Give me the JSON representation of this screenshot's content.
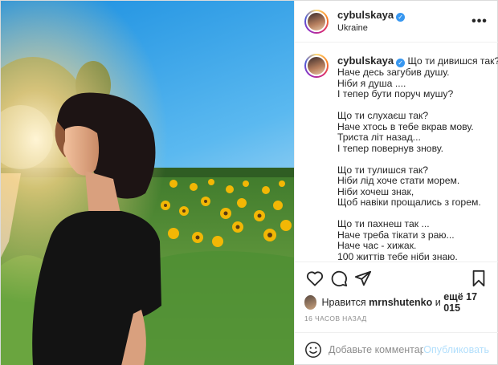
{
  "post": {
    "username": "cybulskaya",
    "verified_mark": "✓",
    "location": "Ukraine",
    "more_icon": "•••",
    "caption_lines": [
      "Що ти дивишся так?",
      "Наче десь загубив душу.",
      "Ніби я душа ....",
      "І тепер бути поруч мушу?",
      "",
      "Що ти слухаєш так?",
      "Наче хтось в тебе вкрав мову.",
      "Триста літ назад...",
      "І тепер повернув знову.",
      "",
      "Що ти тулишся так?",
      "Ніби лід хоче стати морем.",
      "Ніби хочеш знак,",
      "Щоб навіки прощались з горем.",
      "",
      "Що ти пахнеш так ...",
      "Наче треба тікати з раю...",
      "Наче час - хижак.",
      "100 життів тебе ніби знаю."
    ],
    "likes": {
      "prefix": "Нравится",
      "user": "mrnshutenko",
      "middle": "и",
      "count": "ещё 17 015"
    },
    "timestamp": "16 часов назад",
    "comment": {
      "placeholder": "Добавьте комментарий...",
      "post_label": "Опубликовать",
      "value": ""
    },
    "icons": {
      "like": "heart-icon",
      "comment": "comment-icon",
      "share": "share-icon",
      "save": "bookmark-icon",
      "emoji": "smile-icon",
      "more": "more-icon"
    },
    "colors": {
      "accent": "#3897f0",
      "post_button_disabled": "#b2dffc",
      "text": "#262626",
      "muted": "#8e8e8e"
    }
  }
}
